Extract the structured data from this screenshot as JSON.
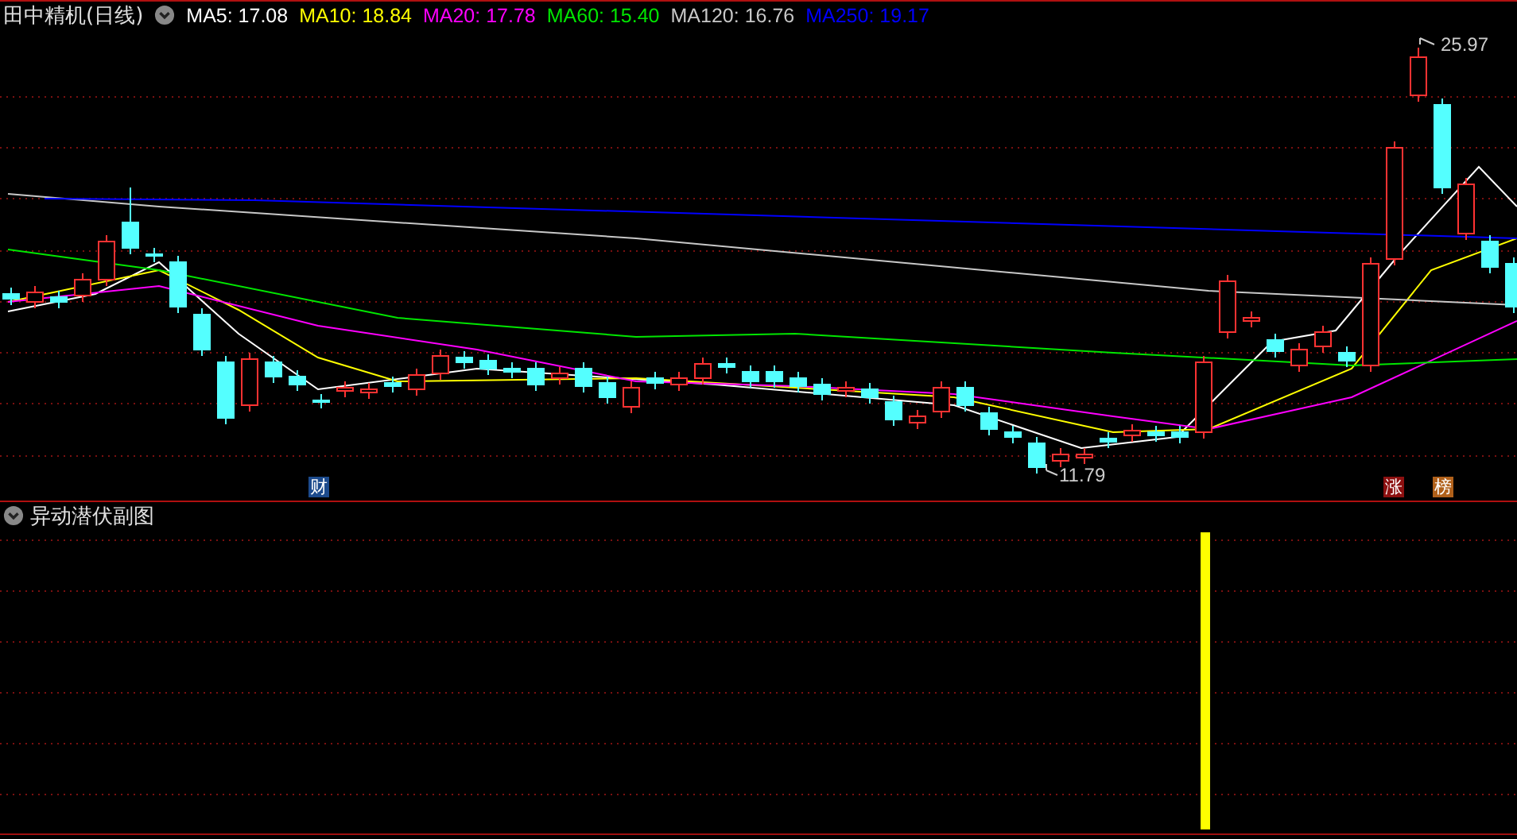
{
  "title": "田中精机(日线)",
  "moving_averages": [
    {
      "label": "MA5: 17.08",
      "color": "#ffffff"
    },
    {
      "label": "MA10: 18.84",
      "color": "#ffff00"
    },
    {
      "label": "MA20: 17.78",
      "color": "#ff00ff"
    },
    {
      "label": "MA60: 15.40",
      "color": "#00e600"
    },
    {
      "label": "MA120: 16.76",
      "color": "#c8c8c8"
    },
    {
      "label": "MA250: 19.17",
      "color": "#0000ff"
    }
  ],
  "high_label": "25.97",
  "low_label": "11.79",
  "event_badges": [
    {
      "label": "财",
      "color": "#1c4a8c"
    },
    {
      "label": "涨",
      "color": "#8c1010"
    },
    {
      "label": "榜",
      "color": "#b0601a"
    }
  ],
  "sub_chart": {
    "title": "异动潜伏副图"
  }
}
